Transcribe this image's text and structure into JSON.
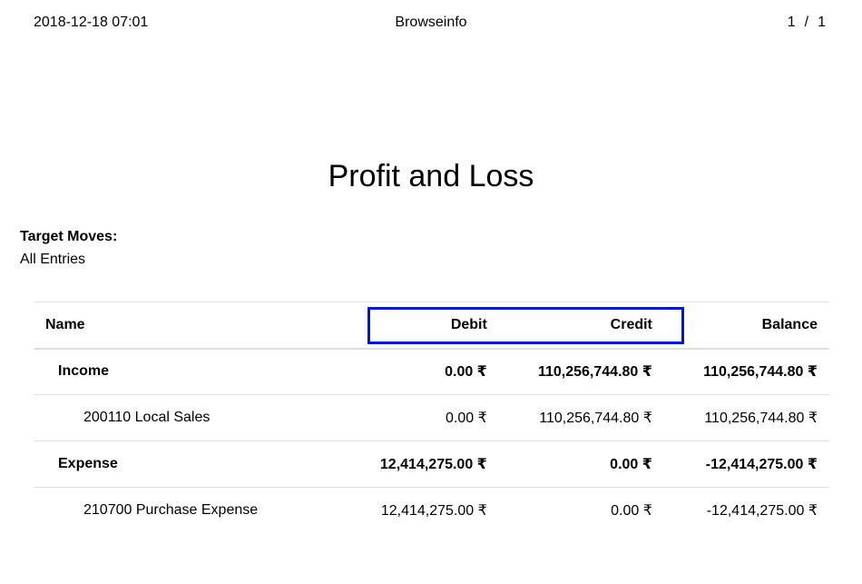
{
  "header": {
    "datetime": "2018-12-18 07:01",
    "company": "Browseinfo",
    "page_current": "1",
    "page_sep": "/",
    "page_total": "1"
  },
  "report": {
    "title": "Profit and Loss",
    "target_moves_label": "Target Moves:",
    "target_moves_value": "All Entries"
  },
  "table": {
    "columns": {
      "name": "Name",
      "debit": "Debit",
      "credit": "Credit",
      "balance": "Balance"
    },
    "rows": [
      {
        "name": "Income",
        "debit": "0.00 ₹",
        "credit": "110,256,744.80 ₹",
        "balance": "110,256,744.80 ₹"
      },
      {
        "name": "200110 Local Sales",
        "debit": "0.00 ₹",
        "credit": "110,256,744.80 ₹",
        "balance": "110,256,744.80 ₹"
      },
      {
        "name": "Expense",
        "debit": "12,414,275.00 ₹",
        "credit": "0.00 ₹",
        "balance": "-12,414,275.00 ₹"
      },
      {
        "name": "210700 Purchase Expense",
        "debit": "12,414,275.00 ₹",
        "credit": "0.00 ₹",
        "balance": "-12,414,275.00 ₹"
      }
    ]
  },
  "highlight": {
    "color": "#0018d6",
    "target": "Debit / Credit column headers"
  }
}
